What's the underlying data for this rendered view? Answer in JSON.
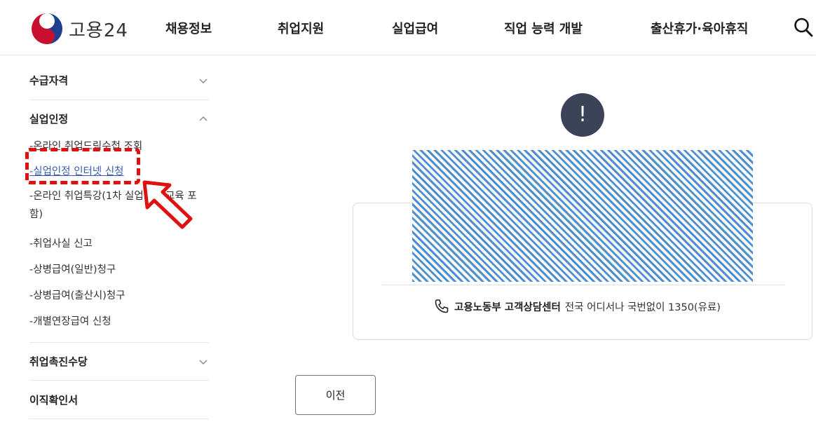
{
  "header": {
    "logo_text": "고용24",
    "nav": [
      "채용정보",
      "취업지원",
      "실업급여",
      "직업 능력 개발",
      "출산휴가·육아휴직"
    ],
    "search_icon": "search-icon"
  },
  "sidebar": {
    "sections": [
      {
        "title": "수급자격",
        "expanded": false
      },
      {
        "title": "실업인정",
        "expanded": true,
        "items": [
          "-온라인 취업드림수첩 조회",
          "-실업인정 인터넷 신청",
          "-온라인 취업특강(1차 실업인정 교육 포함)",
          "-취업사실 신고",
          "-상병급여(일반)청구",
          "-상병급여(출산시)청구",
          "-개별연장급여 신청"
        ],
        "active_index": 1
      },
      {
        "title": "취업촉진수당",
        "expanded": false
      },
      {
        "title": "이직확인서",
        "expanded": false
      }
    ]
  },
  "main": {
    "alert_symbol": "!",
    "contact": {
      "label": "고용노동부 고객상담센터",
      "text": "전국 어디서나 국번없이 1350(유료)"
    },
    "prev_button": "이전"
  },
  "colors": {
    "annotation": "#e01010",
    "alert_bg": "#3b4358",
    "link_active": "#3b5bb6",
    "placeholder_stripe": "#4d8fcf"
  }
}
